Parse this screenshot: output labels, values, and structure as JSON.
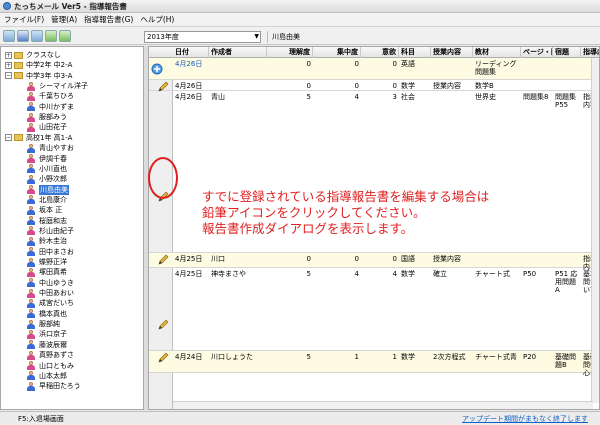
{
  "window": {
    "title": "たっちメール Ver5 - 指導報告書"
  },
  "menu": [
    "ファイル(F)",
    "管理(A)",
    "指導報告書(G)",
    "ヘルプ(H)"
  ],
  "toolbar": {
    "year": "2013年度",
    "user": "川島由美"
  },
  "tree": [
    {
      "label": "クラスなし",
      "type": "folder",
      "toggle": "+",
      "indent": 0
    },
    {
      "label": "中学2年  中2-A",
      "type": "folder",
      "toggle": "+",
      "indent": 0
    },
    {
      "label": "中学3年  中3-A",
      "type": "folder",
      "toggle": "−",
      "indent": 0
    },
    {
      "label": "シーマイル洋子",
      "type": "person",
      "color": "#d84a8a",
      "indent": 1
    },
    {
      "label": "千葉ちひろ",
      "type": "person",
      "color": "#d84a8a",
      "indent": 1
    },
    {
      "label": "中川かずま",
      "type": "person",
      "color": "#3a6ad8",
      "indent": 1
    },
    {
      "label": "服部みう",
      "type": "person",
      "color": "#d84a8a",
      "indent": 1
    },
    {
      "label": "山田花子",
      "type": "person",
      "color": "#d84a8a",
      "indent": 1
    },
    {
      "label": "高校1年  高1-A",
      "type": "folder",
      "toggle": "−",
      "indent": 0
    },
    {
      "label": "青山やすお",
      "type": "person",
      "color": "#3a6ad8",
      "indent": 1
    },
    {
      "label": "伊調千春",
      "type": "person",
      "color": "#d84a8a",
      "indent": 1
    },
    {
      "label": "小川直也",
      "type": "person",
      "color": "#3a6ad8",
      "indent": 1
    },
    {
      "label": "小野次郎",
      "type": "person",
      "color": "#3a6ad8",
      "indent": 1
    },
    {
      "label": "川島由美",
      "type": "person",
      "color": "#d84a8a",
      "indent": 1,
      "selected": true
    },
    {
      "label": "北島康介",
      "type": "person",
      "color": "#3a6ad8",
      "indent": 1
    },
    {
      "label": "坂本  正",
      "type": "person",
      "color": "#3a6ad8",
      "indent": 1
    },
    {
      "label": "桜庭和志",
      "type": "person",
      "color": "#3a6ad8",
      "indent": 1
    },
    {
      "label": "杉山由紀子",
      "type": "person",
      "color": "#d84a8a",
      "indent": 1
    },
    {
      "label": "鈴木圭治",
      "type": "person",
      "color": "#3a6ad8",
      "indent": 1
    },
    {
      "label": "田中まさお",
      "type": "person",
      "color": "#3a6ad8",
      "indent": 1
    },
    {
      "label": "蝶野正洋",
      "type": "person",
      "color": "#3a6ad8",
      "indent": 1
    },
    {
      "label": "塚田真希",
      "type": "person",
      "color": "#d84a8a",
      "indent": 1
    },
    {
      "label": "中山ゆうき",
      "type": "person",
      "color": "#3a6ad8",
      "indent": 1
    },
    {
      "label": "中田あおい",
      "type": "person",
      "color": "#d84a8a",
      "indent": 1
    },
    {
      "label": "成宮だいち",
      "type": "person",
      "color": "#3a6ad8",
      "indent": 1
    },
    {
      "label": "橋本真也",
      "type": "person",
      "color": "#3a6ad8",
      "indent": 1
    },
    {
      "label": "服部純",
      "type": "person",
      "color": "#3a6ad8",
      "indent": 1
    },
    {
      "label": "浜口京子",
      "type": "person",
      "color": "#d84a8a",
      "indent": 1
    },
    {
      "label": "藤波辰爾",
      "type": "person",
      "color": "#3a6ad8",
      "indent": 1
    },
    {
      "label": "真野あずさ",
      "type": "person",
      "color": "#d84a8a",
      "indent": 1
    },
    {
      "label": "山口ともみ",
      "type": "person",
      "color": "#d84a8a",
      "indent": 1
    },
    {
      "label": "山本太郎",
      "type": "person",
      "color": "#3a6ad8",
      "indent": 1
    },
    {
      "label": "早稲田たろう",
      "type": "person",
      "color": "#3a6ad8",
      "indent": 1
    }
  ],
  "grid": {
    "columns": [
      "日付",
      "作成者",
      "理解度",
      "集中度",
      "意欲",
      "科目",
      "授業内容",
      "教材",
      "ページ・問",
      "宿題",
      "指導内"
    ],
    "rows": [
      {
        "date": "4月26日",
        "author": "",
        "c1": "0",
        "c2": "0",
        "c3": "0",
        "subject": "英語",
        "content": "",
        "material": "リーディング問題集",
        "page": "",
        "hw": "",
        "note": "",
        "icon": "new",
        "highlight": true
      },
      {
        "date": "4月26日",
        "author": "",
        "c1": "0",
        "c2": "0",
        "c3": "0",
        "subject": "数学",
        "content": "授業内容",
        "material": "数学B",
        "page": "",
        "hw": "",
        "note": "",
        "icon": "pencil"
      },
      {
        "date": "4月26日",
        "author": "青山",
        "c1": "5",
        "c2": "4",
        "c3": "3",
        "subject": "社会",
        "content": "",
        "material": "世界史",
        "page": "問題集8",
        "hw": "問題集P55",
        "note": "指導内容",
        "icon": "pencil"
      },
      {
        "date": "4月25日",
        "author": "川口",
        "c1": "0",
        "c2": "0",
        "c3": "0",
        "subject": "国語",
        "content": "授業内容",
        "material": "",
        "page": "",
        "hw": "",
        "note": "指導内",
        "icon": "pencil",
        "highlight": true
      },
      {
        "date": "4月25日",
        "author": "神寺まさや",
        "c1": "5",
        "c2": "4",
        "c3": "4",
        "subject": "数学",
        "content": "確立",
        "material": "チャート式",
        "page": "P50",
        "hw": "P51 応用問題A",
        "note": "基本問ついて",
        "icon": "pencil"
      },
      {
        "date": "4月24日",
        "author": "川口しょうた",
        "c1": "5",
        "c2": "1",
        "c3": "1",
        "subject": "数学",
        "content": "2次方程式",
        "material": "チャート式青",
        "page": "P20",
        "hw": "基礎問題B",
        "note": "基礎問中心に",
        "icon": "pencil",
        "highlight": true
      }
    ]
  },
  "instruction": [
    "すでに登録されている指導報告書を編集する場合は",
    "鉛筆アイコンをクリックしてください。",
    "報告書作成ダイアログを表示します。"
  ],
  "status": {
    "left": "F5:入退場画面",
    "right": "アップデート期間がまもなく終了します"
  },
  "colors": {
    "annotation": "#e02020",
    "selection": "#3a78d8",
    "row_highlight": "#fdfbe2"
  }
}
